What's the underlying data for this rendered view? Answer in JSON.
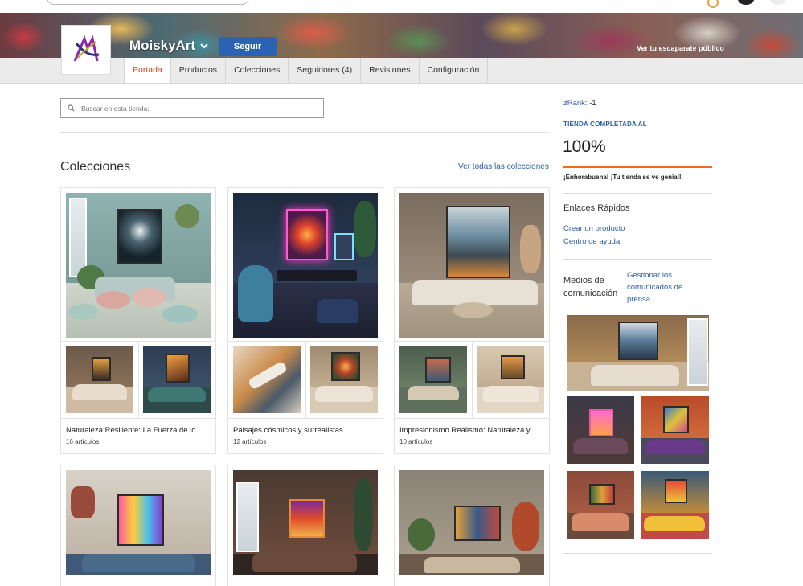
{
  "header": {
    "store_name": "MoiskyArt",
    "follow_label": "Seguir",
    "public_link": "Ver tu escaparate público"
  },
  "nav": {
    "tabs": [
      {
        "label": "Portada",
        "active": true
      },
      {
        "label": "Productos",
        "active": false
      },
      {
        "label": "Colecciones",
        "active": false
      },
      {
        "label": "Seguidores (4)",
        "active": false
      },
      {
        "label": "Revisiones",
        "active": false
      },
      {
        "label": "Configuración",
        "active": false
      }
    ]
  },
  "search": {
    "placeholder": "Buscar en esta tienda:"
  },
  "collections": {
    "title": "Colecciones",
    "see_all": "Ver todas las colecciones",
    "items": [
      {
        "title": "Naturaleza Resiliente: La Fuerza de lo...",
        "count": "16 artículos"
      },
      {
        "title": "Paisajes cósmicos y surrealistas",
        "count": "12 artículos"
      },
      {
        "title": "Impresionismo Realismo: Naturaleza y ...",
        "count": "10 artículos"
      }
    ]
  },
  "sidebar": {
    "zrank_label": "zRank:",
    "zrank_value": "-1",
    "completed_label": "TIENDA COMPLETADA AL",
    "completed_percent": "100%",
    "completed_fraction": 1.0,
    "congrats": "¡Enhorabuena! ¡Tu tienda se ve genial!",
    "quick_links_title": "Enlaces Rápidos",
    "quick_links": [
      "Crear un producto",
      "Centro de ayuda"
    ],
    "media_title": "Medios de comunicación",
    "media_link": "Gestionar los comunicados de prensa"
  },
  "colors": {
    "accent_blue": "#2a63b4",
    "link_blue": "#2a5fa8",
    "active_tab_orange": "#cc4a22",
    "progress_orange": "#f26a21"
  }
}
